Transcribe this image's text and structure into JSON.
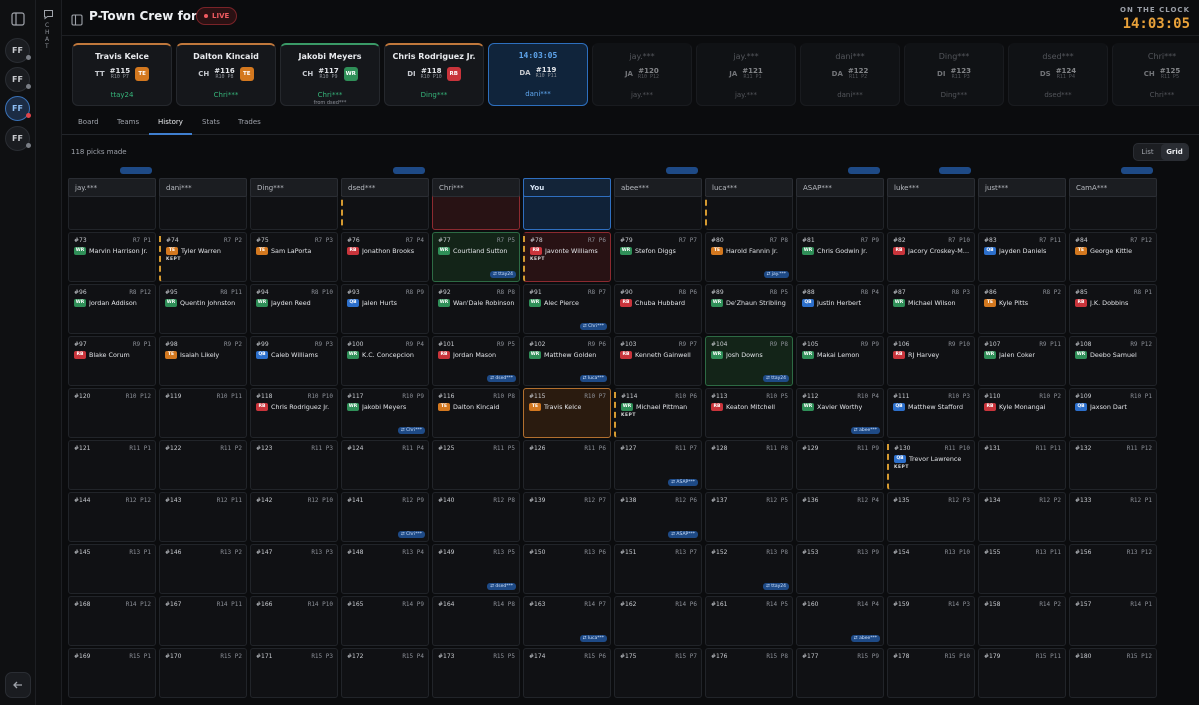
{
  "header": {
    "title": "P-Town Crew for Life",
    "live": "LIVE",
    "clock_label": "ON THE CLOCK",
    "clock_value": "14:03:05"
  },
  "rail": {
    "avatars": [
      "FF",
      "FF",
      "FF",
      "FF"
    ],
    "chat_label": "CHAT"
  },
  "cards": [
    {
      "name": "Travis Kelce",
      "ini": "TT",
      "pick": "#115",
      "rp": "R10 P7",
      "pos": "TE",
      "user": "ttay24",
      "sub": "",
      "state": "done"
    },
    {
      "name": "Dalton Kincaid",
      "ini": "CH",
      "pick": "#116",
      "rp": "R10 P8",
      "pos": "TE",
      "user": "Chri***",
      "sub": "",
      "state": "done"
    },
    {
      "name": "Jakobi Meyers",
      "ini": "CH",
      "pick": "#117",
      "rp": "R10 P9",
      "pos": "WR",
      "user": "Chri***",
      "sub": "from dsed***",
      "state": "doneg"
    },
    {
      "name": "Chris Rodriguez Jr.",
      "ini": "DI",
      "pick": "#118",
      "rp": "R10 P10",
      "pos": "RB",
      "user": "Ding***",
      "sub": "",
      "state": "done"
    },
    {
      "name": "14:03:05",
      "ini": "DA",
      "pick": "#119",
      "rp": "R10 P11",
      "pos": "",
      "user": "dani***",
      "sub": "",
      "state": "cur"
    },
    {
      "name": "jay.***",
      "ini": "JA",
      "pick": "#120",
      "rp": "R10 P12",
      "pos": "",
      "user": "jay.***",
      "sub": "",
      "state": "fut"
    },
    {
      "name": "jay.***",
      "ini": "JA",
      "pick": "#121",
      "rp": "R11 P1",
      "pos": "",
      "user": "jay.***",
      "sub": "",
      "state": "fut"
    },
    {
      "name": "dani***",
      "ini": "DA",
      "pick": "#122",
      "rp": "R11 P2",
      "pos": "",
      "user": "dani***",
      "sub": "",
      "state": "fut"
    },
    {
      "name": "Ding***",
      "ini": "DI",
      "pick": "#123",
      "rp": "R11 P3",
      "pos": "",
      "user": "Ding***",
      "sub": "",
      "state": "fut"
    },
    {
      "name": "dsed***",
      "ini": "DS",
      "pick": "#124",
      "rp": "R11 P4",
      "pos": "",
      "user": "dsed***",
      "sub": "",
      "state": "fut"
    },
    {
      "name": "Chri***",
      "ini": "CH",
      "pick": "#125",
      "rp": "R11 P5",
      "pos": "",
      "user": "Chri***",
      "sub": "",
      "state": "fut"
    }
  ],
  "tabs": [
    "Board",
    "Teams",
    "History",
    "Stats",
    "Trades"
  ],
  "picks_made": "118 picks made",
  "view": {
    "list": "List",
    "grid": "Grid"
  },
  "columns": [
    "jay.***",
    "dani***",
    "Ding***",
    "dsed***",
    "Chri***",
    "You",
    "abee***",
    "luca***",
    "ASAP***",
    "luke***",
    "just***",
    "CamA***"
  ],
  "ghosts": [
    {
      "c": 0,
      "t": "⇄ luke***"
    },
    {
      "c": 3,
      "t": "⇄ asap***"
    },
    {
      "c": 6,
      "t": "⇄ asap***"
    },
    {
      "c": 8,
      "t": "⇄ dsed***"
    },
    {
      "c": 9,
      "t": "⇄ Ding***"
    },
    {
      "c": 12,
      "t": "⇄ asap***"
    }
  ],
  "rows": [
    [
      {
        "n": "#73",
        "rp": "R7 P1",
        "pos": "WR",
        "p": "Marvin Harrison Jr."
      },
      {
        "n": "#74",
        "rp": "R7 P2",
        "pos": "TE",
        "p": "Tyler Warren",
        "kept": true
      },
      {
        "n": "#75",
        "rp": "R7 P3",
        "pos": "TE",
        "p": "Sam LaPorta"
      },
      {
        "n": "#76",
        "rp": "R7 P4",
        "pos": "RB",
        "p": "Jonathon Brooks"
      },
      {
        "n": "#77",
        "rp": "R7 P5",
        "pos": "WR",
        "p": "Courtland Sutton",
        "hl": "g",
        "t": "⇄ ttay24"
      },
      {
        "n": "#78",
        "rp": "R7 P6",
        "pos": "RB",
        "p": "Javonte Williams",
        "hl": "r",
        "kept": true
      },
      {
        "n": "#79",
        "rp": "R7 P7",
        "pos": "WR",
        "p": "Stefon Diggs"
      },
      {
        "n": "#80",
        "rp": "R7 P8",
        "pos": "TE",
        "p": "Harold Fannin Jr.",
        "t": "⇄ jay.***"
      },
      {
        "n": "#81",
        "rp": "R7 P9",
        "pos": "WR",
        "p": "Chris Godwin Jr."
      },
      {
        "n": "#82",
        "rp": "R7 P10",
        "pos": "RB",
        "p": "Jacory Croskey-Merritt"
      },
      {
        "n": "#83",
        "rp": "R7 P11",
        "pos": "QB",
        "p": "Jayden Daniels"
      },
      {
        "n": "#84",
        "rp": "R7 P12",
        "pos": "TE",
        "p": "George Kittle"
      }
    ],
    [
      {
        "n": "#96",
        "rp": "R8 P12",
        "pos": "WR",
        "p": "Jordan Addison"
      },
      {
        "n": "#95",
        "rp": "R8 P11",
        "pos": "WR",
        "p": "Quentin Johnston"
      },
      {
        "n": "#94",
        "rp": "R8 P10",
        "pos": "WR",
        "p": "Jayden Reed"
      },
      {
        "n": "#93",
        "rp": "R8 P9",
        "pos": "QB",
        "p": "Jalen Hurts"
      },
      {
        "n": "#92",
        "rp": "R8 P8",
        "pos": "WR",
        "p": "Wan'Dale Robinson"
      },
      {
        "n": "#91",
        "rp": "R8 P7",
        "pos": "WR",
        "p": "Alec Pierce",
        "t": "⇄ Chri***"
      },
      {
        "n": "#90",
        "rp": "R8 P6",
        "pos": "RB",
        "p": "Chuba Hubbard"
      },
      {
        "n": "#89",
        "rp": "R8 P5",
        "pos": "WR",
        "p": "De'Zhaun Stribling"
      },
      {
        "n": "#88",
        "rp": "R8 P4",
        "pos": "QB",
        "p": "Justin Herbert"
      },
      {
        "n": "#87",
        "rp": "R8 P3",
        "pos": "WR",
        "p": "Michael Wilson"
      },
      {
        "n": "#86",
        "rp": "R8 P2",
        "pos": "TE",
        "p": "Kyle Pitts"
      },
      {
        "n": "#85",
        "rp": "R8 P1",
        "pos": "RB",
        "p": "J.K. Dobbins"
      }
    ],
    [
      {
        "n": "#97",
        "rp": "R9 P1",
        "pos": "RB",
        "p": "Blake Corum"
      },
      {
        "n": "#98",
        "rp": "R9 P2",
        "pos": "TE",
        "p": "Isaiah Likely"
      },
      {
        "n": "#99",
        "rp": "R9 P3",
        "pos": "QB",
        "p": "Caleb Williams"
      },
      {
        "n": "#100",
        "rp": "R9 P4",
        "pos": "WR",
        "p": "K.C. Concepcion"
      },
      {
        "n": "#101",
        "rp": "R9 P5",
        "pos": "RB",
        "p": "Jordan Mason",
        "t": "⇄ dsed***"
      },
      {
        "n": "#102",
        "rp": "R9 P6",
        "pos": "WR",
        "p": "Matthew Golden",
        "t": "⇄ luca***"
      },
      {
        "n": "#103",
        "rp": "R9 P7",
        "pos": "RB",
        "p": "Kenneth Gainwell"
      },
      {
        "n": "#104",
        "rp": "R9 P8",
        "pos": "WR",
        "p": "Josh Downs",
        "hl": "g",
        "t": "⇄ ttay24"
      },
      {
        "n": "#105",
        "rp": "R9 P9",
        "pos": "WR",
        "p": "Makai Lemon"
      },
      {
        "n": "#106",
        "rp": "R9 P10",
        "pos": "RB",
        "p": "RJ Harvey"
      },
      {
        "n": "#107",
        "rp": "R9 P11",
        "pos": "WR",
        "p": "Jalen Coker"
      },
      {
        "n": "#108",
        "rp": "R9 P12",
        "pos": "WR",
        "p": "Deebo Samuel"
      }
    ],
    [
      {
        "n": "#120",
        "rp": "R10 P12"
      },
      {
        "n": "#119",
        "rp": "R10 P11"
      },
      {
        "n": "#118",
        "rp": "R10 P10",
        "pos": "RB",
        "p": "Chris Rodriguez Jr."
      },
      {
        "n": "#117",
        "rp": "R10 P9",
        "pos": "WR",
        "p": "Jakobi Meyers",
        "t": "⇄ Chri***"
      },
      {
        "n": "#116",
        "rp": "R10 P8",
        "pos": "TE",
        "p": "Dalton Kincaid"
      },
      {
        "n": "#115",
        "rp": "R10 P7",
        "pos": "TE",
        "p": "Travis Kelce",
        "hl": "o"
      },
      {
        "n": "#114",
        "rp": "R10 P6",
        "pos": "WR",
        "p": "Michael Pittman",
        "kept": true
      },
      {
        "n": "#113",
        "rp": "R10 P5",
        "pos": "RB",
        "p": "Keaton Mitchell"
      },
      {
        "n": "#112",
        "rp": "R10 P4",
        "pos": "WR",
        "p": "Xavier Worthy",
        "t": "⇄ abee***"
      },
      {
        "n": "#111",
        "rp": "R10 P3",
        "pos": "QB",
        "p": "Matthew Stafford"
      },
      {
        "n": "#110",
        "rp": "R10 P2",
        "pos": "RB",
        "p": "Kyle Monangai"
      },
      {
        "n": "#109",
        "rp": "R10 P1",
        "pos": "QB",
        "p": "Jaxson Dart"
      }
    ],
    [
      {
        "n": "#121",
        "rp": "R11 P1"
      },
      {
        "n": "#122",
        "rp": "R11 P2"
      },
      {
        "n": "#123",
        "rp": "R11 P3"
      },
      {
        "n": "#124",
        "rp": "R11 P4"
      },
      {
        "n": "#125",
        "rp": "R11 P5"
      },
      {
        "n": "#126",
        "rp": "R11 P6"
      },
      {
        "n": "#127",
        "rp": "R11 P7",
        "t": "⇄ ASAP***"
      },
      {
        "n": "#128",
        "rp": "R11 P8"
      },
      {
        "n": "#129",
        "rp": "R11 P9"
      },
      {
        "n": "#130",
        "rp": "R11 P10",
        "pos": "QB",
        "p": "Trevor Lawrence",
        "kept": true
      },
      {
        "n": "#131",
        "rp": "R11 P11"
      },
      {
        "n": "#132",
        "rp": "R11 P12"
      }
    ],
    [
      {
        "n": "#144",
        "rp": "R12 P12"
      },
      {
        "n": "#143",
        "rp": "R12 P11"
      },
      {
        "n": "#142",
        "rp": "R12 P10"
      },
      {
        "n": "#141",
        "rp": "R12 P9",
        "t": "⇄ Chri***"
      },
      {
        "n": "#140",
        "rp": "R12 P8"
      },
      {
        "n": "#139",
        "rp": "R12 P7"
      },
      {
        "n": "#138",
        "rp": "R12 P6",
        "t": "⇄ ASAP***"
      },
      {
        "n": "#137",
        "rp": "R12 P5"
      },
      {
        "n": "#136",
        "rp": "R12 P4"
      },
      {
        "n": "#135",
        "rp": "R12 P3"
      },
      {
        "n": "#134",
        "rp": "R12 P2"
      },
      {
        "n": "#133",
        "rp": "R12 P1"
      }
    ],
    [
      {
        "n": "#145",
        "rp": "R13 P1"
      },
      {
        "n": "#146",
        "rp": "R13 P2"
      },
      {
        "n": "#147",
        "rp": "R13 P3"
      },
      {
        "n": "#148",
        "rp": "R13 P4"
      },
      {
        "n": "#149",
        "rp": "R13 P5",
        "t": "⇄ dsed***"
      },
      {
        "n": "#150",
        "rp": "R13 P6"
      },
      {
        "n": "#151",
        "rp": "R13 P7"
      },
      {
        "n": "#152",
        "rp": "R13 P8",
        "t": "⇄ ttay24"
      },
      {
        "n": "#153",
        "rp": "R13 P9"
      },
      {
        "n": "#154",
        "rp": "R13 P10"
      },
      {
        "n": "#155",
        "rp": "R13 P11"
      },
      {
        "n": "#156",
        "rp": "R13 P12"
      }
    ],
    [
      {
        "n": "#168",
        "rp": "R14 P12"
      },
      {
        "n": "#167",
        "rp": "R14 P11"
      },
      {
        "n": "#166",
        "rp": "R14 P10"
      },
      {
        "n": "#165",
        "rp": "R14 P9"
      },
      {
        "n": "#164",
        "rp": "R14 P8"
      },
      {
        "n": "#163",
        "rp": "R14 P7",
        "t": "⇄ luca***"
      },
      {
        "n": "#162",
        "rp": "R14 P6"
      },
      {
        "n": "#161",
        "rp": "R14 P5"
      },
      {
        "n": "#160",
        "rp": "R14 P4",
        "t": "⇄ abee***"
      },
      {
        "n": "#159",
        "rp": "R14 P3"
      },
      {
        "n": "#158",
        "rp": "R14 P2"
      },
      {
        "n": "#157",
        "rp": "R14 P1"
      }
    ],
    [
      {
        "n": "#169",
        "rp": "R15 P1"
      },
      {
        "n": "#170",
        "rp": "R15 P2"
      },
      {
        "n": "#171",
        "rp": "R15 P3"
      },
      {
        "n": "#172",
        "rp": "R15 P4"
      },
      {
        "n": "#173",
        "rp": "R15 P5"
      },
      {
        "n": "#174",
        "rp": "R15 P6"
      },
      {
        "n": "#175",
        "rp": "R15 P7"
      },
      {
        "n": "#176",
        "rp": "R15 P8"
      },
      {
        "n": "#177",
        "rp": "R15 P9"
      },
      {
        "n": "#178",
        "rp": "R15 P10"
      },
      {
        "n": "#179",
        "rp": "R15 P11"
      },
      {
        "n": "#180",
        "rp": "R15 P12"
      }
    ]
  ],
  "kept_label": "KEPT",
  "colors": {
    "QB": "#2c6fcb",
    "RB": "#c9343b",
    "WR": "#2f8f58",
    "TE": "#d3781f",
    "accent": "#3f7fd0",
    "clock": "#e9a23a"
  }
}
